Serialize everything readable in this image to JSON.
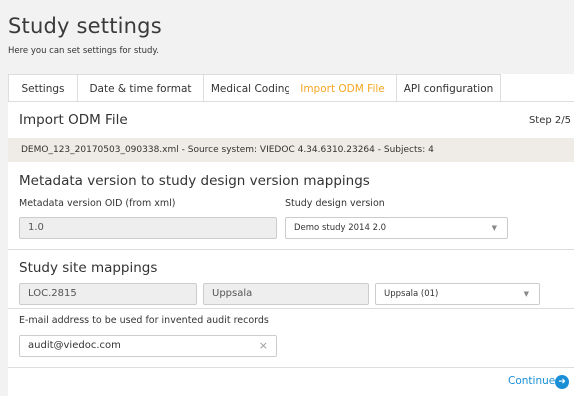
{
  "page": {
    "title": "Study settings",
    "subtitle": "Here you can set settings for study."
  },
  "tabs": [
    {
      "label": "Settings"
    },
    {
      "label": "Date & time format"
    },
    {
      "label": "Medical Coding"
    },
    {
      "label": "Import ODM File"
    },
    {
      "label": "API configuration"
    }
  ],
  "active_tab": "Import ODM File",
  "import": {
    "header": "Import ODM File",
    "step": "Step 2/5",
    "info": "DEMO_123_20170503_090338.xml - Source system: VIEDOC 4.34.6310.23264 - Subjects: 4"
  },
  "metadata_section": {
    "title": "Metadata version to study design version mappings",
    "oid_label": "Metadata version OID (from xml)",
    "oid_value": "1.0",
    "design_label": "Study design version",
    "design_value": "Demo study 2014 2.0"
  },
  "site_section": {
    "title": "Study site mappings",
    "site_code": "LOC.2815",
    "site_name": "Uppsala",
    "site_select": "Uppsala (01)"
  },
  "email": {
    "label": "E-mail address to be used for invented audit records",
    "value": "audit@viedoc.com"
  },
  "footer": {
    "continue_label": "Continue"
  },
  "icons": {
    "caret": "chevron-down-icon",
    "clear": "close-icon",
    "continue": "arrow-right-circle-icon"
  },
  "colors": {
    "accent": "#f6a623",
    "link": "#1a8fd6"
  }
}
